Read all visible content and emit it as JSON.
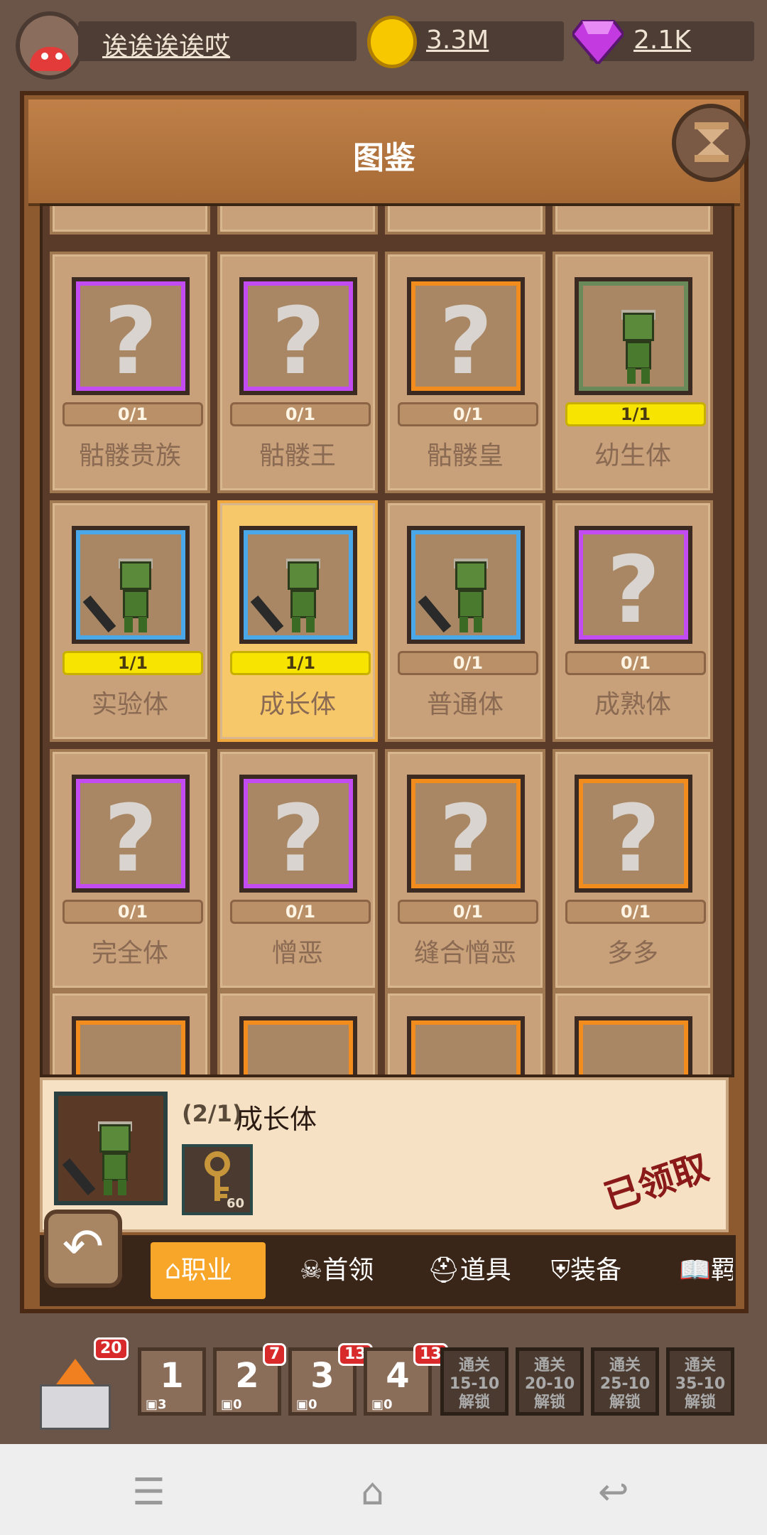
{
  "player": {
    "name": "诶诶诶诶哎",
    "gold": "3.3M",
    "gems": "2.1K"
  },
  "panel": {
    "title": "图鉴"
  },
  "cards": [
    {
      "name": "骷髅贵族",
      "count": "0/1",
      "frame": "purple",
      "unlocked": false
    },
    {
      "name": "骷髅王",
      "count": "0/1",
      "frame": "purple",
      "unlocked": false
    },
    {
      "name": "骷髅皇",
      "count": "0/1",
      "frame": "orange",
      "unlocked": false
    },
    {
      "name": "幼生体",
      "count": "1/1",
      "frame": "green",
      "unlocked": true
    },
    {
      "name": "实验体",
      "count": "1/1",
      "frame": "blue",
      "unlocked": true
    },
    {
      "name": "成长体",
      "count": "1/1",
      "frame": "blue",
      "unlocked": true,
      "selected": true
    },
    {
      "name": "普通体",
      "count": "0/1",
      "frame": "blue",
      "unlocked": true
    },
    {
      "name": "成熟体",
      "count": "0/1",
      "frame": "purple",
      "unlocked": false
    },
    {
      "name": "完全体",
      "count": "0/1",
      "frame": "purple",
      "unlocked": false
    },
    {
      "name": "憎恶",
      "count": "0/1",
      "frame": "purple",
      "unlocked": false
    },
    {
      "name": "缝合憎恶",
      "count": "0/1",
      "frame": "orange",
      "unlocked": false
    },
    {
      "name": "多多",
      "count": "0/1",
      "frame": "orange",
      "unlocked": false
    }
  ],
  "detail": {
    "count": "(2/1)",
    "name": "成长体",
    "key_count": "60",
    "stamp": "已领取"
  },
  "tabs": [
    {
      "label": "职业",
      "active": true
    },
    {
      "label": "首领"
    },
    {
      "label": "道具"
    },
    {
      "label": "装备"
    },
    {
      "label": "羁绊"
    }
  ],
  "castle": {
    "level_badge": "20"
  },
  "levels": [
    {
      "num": "1",
      "chests": "3",
      "badge": ""
    },
    {
      "num": "2",
      "chests": "0",
      "badge": "7"
    },
    {
      "num": "3",
      "chests": "0",
      "badge": "13"
    },
    {
      "num": "4",
      "chests": "0",
      "badge": "13"
    }
  ],
  "locked_levels": [
    {
      "line1": "通关",
      "line2": "15-10",
      "line3": "解锁"
    },
    {
      "line1": "通关",
      "line2": "20-10",
      "line3": "解锁"
    },
    {
      "line1": "通关",
      "line2": "25-10",
      "line3": "解锁"
    },
    {
      "line1": "通关",
      "line2": "35-10",
      "line3": "解锁"
    }
  ],
  "icons": {
    "back": "back-arrow-icon",
    "help": "hourglass-icon"
  }
}
